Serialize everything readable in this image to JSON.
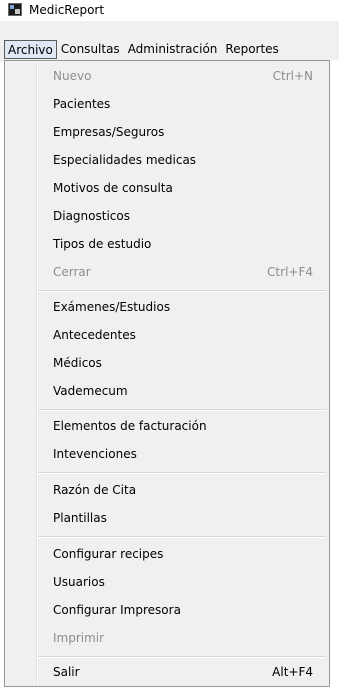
{
  "window": {
    "title": "MedicReport"
  },
  "menubar": {
    "items": [
      {
        "label": "Archivo"
      },
      {
        "label": "Consultas"
      },
      {
        "label": "Administración"
      },
      {
        "label": "Reportes"
      }
    ]
  },
  "dropdown": {
    "items": [
      {
        "label": "Nuevo",
        "shortcut": "Ctrl+N",
        "enabled": false
      },
      {
        "label": "Pacientes",
        "shortcut": "",
        "enabled": true
      },
      {
        "label": "Empresas/Seguros",
        "shortcut": "",
        "enabled": true
      },
      {
        "label": "Especialidades medicas",
        "shortcut": "",
        "enabled": true
      },
      {
        "label": "Motivos de consulta",
        "shortcut": "",
        "enabled": true
      },
      {
        "label": "Diagnosticos",
        "shortcut": "",
        "enabled": true
      },
      {
        "label": "Tipos de estudio",
        "shortcut": "",
        "enabled": true
      },
      {
        "label": "Cerrar",
        "shortcut": "Ctrl+F4",
        "enabled": false
      },
      {
        "label": "Exámenes/Estudios",
        "shortcut": "",
        "enabled": true
      },
      {
        "label": "Antecedentes",
        "shortcut": "",
        "enabled": true
      },
      {
        "label": "Médicos",
        "shortcut": "",
        "enabled": true
      },
      {
        "label": "Vademecum",
        "shortcut": "",
        "enabled": true
      },
      {
        "label": "Elementos de facturación",
        "shortcut": "",
        "enabled": true
      },
      {
        "label": "Intevenciones",
        "shortcut": "",
        "enabled": true
      },
      {
        "label": "Razón de Cita",
        "shortcut": "",
        "enabled": true
      },
      {
        "label": "Plantillas",
        "shortcut": "",
        "enabled": true
      },
      {
        "label": "Configurar recipes",
        "shortcut": "",
        "enabled": true
      },
      {
        "label": "Usuarios",
        "shortcut": "",
        "enabled": true
      },
      {
        "label": "Configurar Impresora",
        "shortcut": "",
        "enabled": true
      },
      {
        "label": "Imprimir",
        "shortcut": "",
        "enabled": false
      },
      {
        "label": "Salir",
        "shortcut": "Alt+F4",
        "enabled": true
      }
    ]
  },
  "colors": {
    "menu_bg": "#f0f0f0",
    "disabled_text": "#8d8d8d",
    "active_menu_bg": "#dfe8f4"
  },
  "icons": {
    "app": "medicreport-app-icon"
  }
}
